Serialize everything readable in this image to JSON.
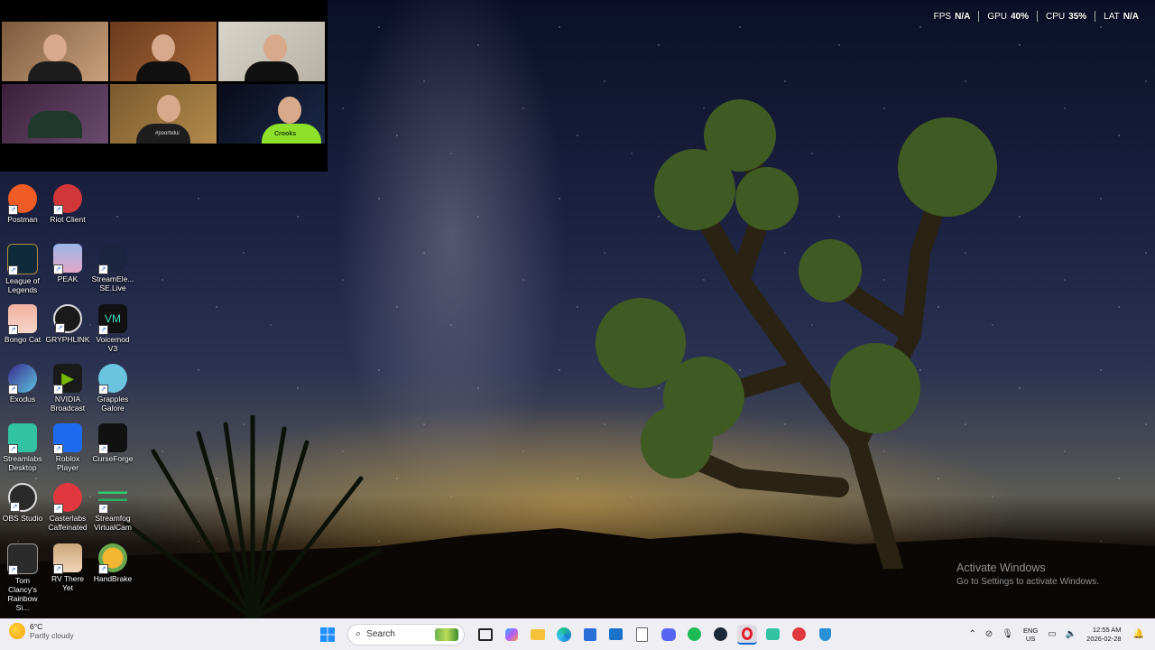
{
  "overlay": {
    "fps_label": "FPS",
    "fps_value": "N/A",
    "gpu_label": "GPU",
    "gpu_value": "40%",
    "cpu_label": "CPU",
    "cpu_value": "35%",
    "lat_label": "LAT",
    "lat_value": "N/A"
  },
  "webcams": {
    "cam5_shirt_text": "#poorbdui",
    "cam6_shirt_text": "Crooks"
  },
  "desktop_icons": [
    {
      "label": "Postman",
      "color": "#ef5b25",
      "icon": "postman-icon"
    },
    {
      "label": "Riot Client",
      "color": "#d13639",
      "icon": "riot-client-icon"
    },
    {
      "label": "League of Legends",
      "color": "#0f2a3a",
      "icon": "league-of-legends-icon"
    },
    {
      "label": "PEAK",
      "color": "#9bb6e8",
      "icon": "peak-icon"
    },
    {
      "label": "StreamEle... SE.Live",
      "color": "#1b2540",
      "icon": "streamelements-icon"
    },
    {
      "label": "Bongo Cat",
      "color": "#f3b0a0",
      "icon": "bongo-cat-icon"
    },
    {
      "label": "GRYPHLINK",
      "color": "#1a1a1a",
      "icon": "gryphlink-icon"
    },
    {
      "label": "Voicemod V3",
      "color": "#111111",
      "icon": "voicemod-icon"
    },
    {
      "label": "Exodus",
      "color": "#3b2a8c",
      "icon": "exodus-icon"
    },
    {
      "label": "NVIDIA Broadcast",
      "color": "#1a1a1a",
      "icon": "nvidia-broadcast-icon"
    },
    {
      "label": "Grapples Galore",
      "color": "#6ac4e0",
      "icon": "grapples-galore-icon"
    },
    {
      "label": "Streamlabs Desktop",
      "color": "#31c3a2",
      "icon": "streamlabs-icon"
    },
    {
      "label": "Roblox Player",
      "color": "#1e6bf0",
      "icon": "roblox-icon"
    },
    {
      "label": "CurseForge",
      "color": "#111111",
      "icon": "curseforge-icon"
    },
    {
      "label": "OBS Studio",
      "color": "#2a2a2a",
      "icon": "obs-studio-icon"
    },
    {
      "label": "Casterlabs Caffeinated",
      "color": "#e0383e",
      "icon": "casterlabs-icon"
    },
    {
      "label": "Streamfog VirtualCam",
      "color": "#0f1a14",
      "icon": "streamfog-icon"
    },
    {
      "label": "Tom Clancy's Rainbow Si...",
      "color": "#2b2b2b",
      "icon": "rainbow-six-icon"
    },
    {
      "label": "RV There Yet",
      "color": "#c9a57a",
      "icon": "rv-there-yet-icon"
    },
    {
      "label": "HandBrake",
      "color": "#f2b632",
      "icon": "handbrake-icon"
    }
  ],
  "activation": {
    "title": "Activate Windows",
    "subtitle": "Go to Settings to activate Windows."
  },
  "taskbar": {
    "weather_temp": "6°C",
    "weather_desc": "Partly cloudy",
    "search_placeholder": "Search",
    "lang_top": "ENG",
    "lang_bottom": "US",
    "time": "12:55 AM",
    "date": "2026-02-28"
  }
}
